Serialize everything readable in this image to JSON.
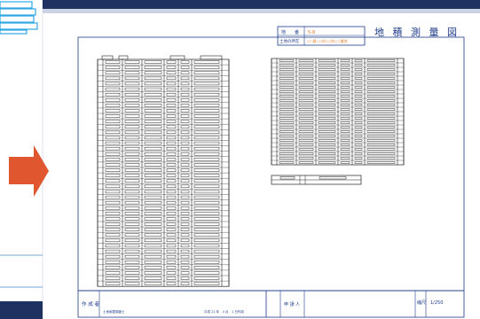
{
  "sheet": {
    "title": "地 積 測 量 図",
    "lot_label": "地　　番",
    "lot_value": "5-8",
    "location_label": "土地の所在",
    "location_value": "○○県○○市○○町○○番地",
    "author_label": "作 成 者",
    "author_name": "土地家屋調査士",
    "date_text": "平成 22 年　4 月　1 日作成",
    "applicant_label": "申 請 人",
    "scale_label": "縮尺",
    "scale_value": "1/250"
  },
  "table_rows": 42,
  "right_table_rows": 24,
  "colors": {
    "header_navy": "#1e3160",
    "arrow": "#e0562f",
    "cyan": "#2ea6e6",
    "frame_blue": "#1d3a8a",
    "orange_text": "#e07a2b"
  },
  "icons": {
    "arrow": "arrow-right-icon",
    "sheet_icon": "spreadsheet-icon"
  }
}
